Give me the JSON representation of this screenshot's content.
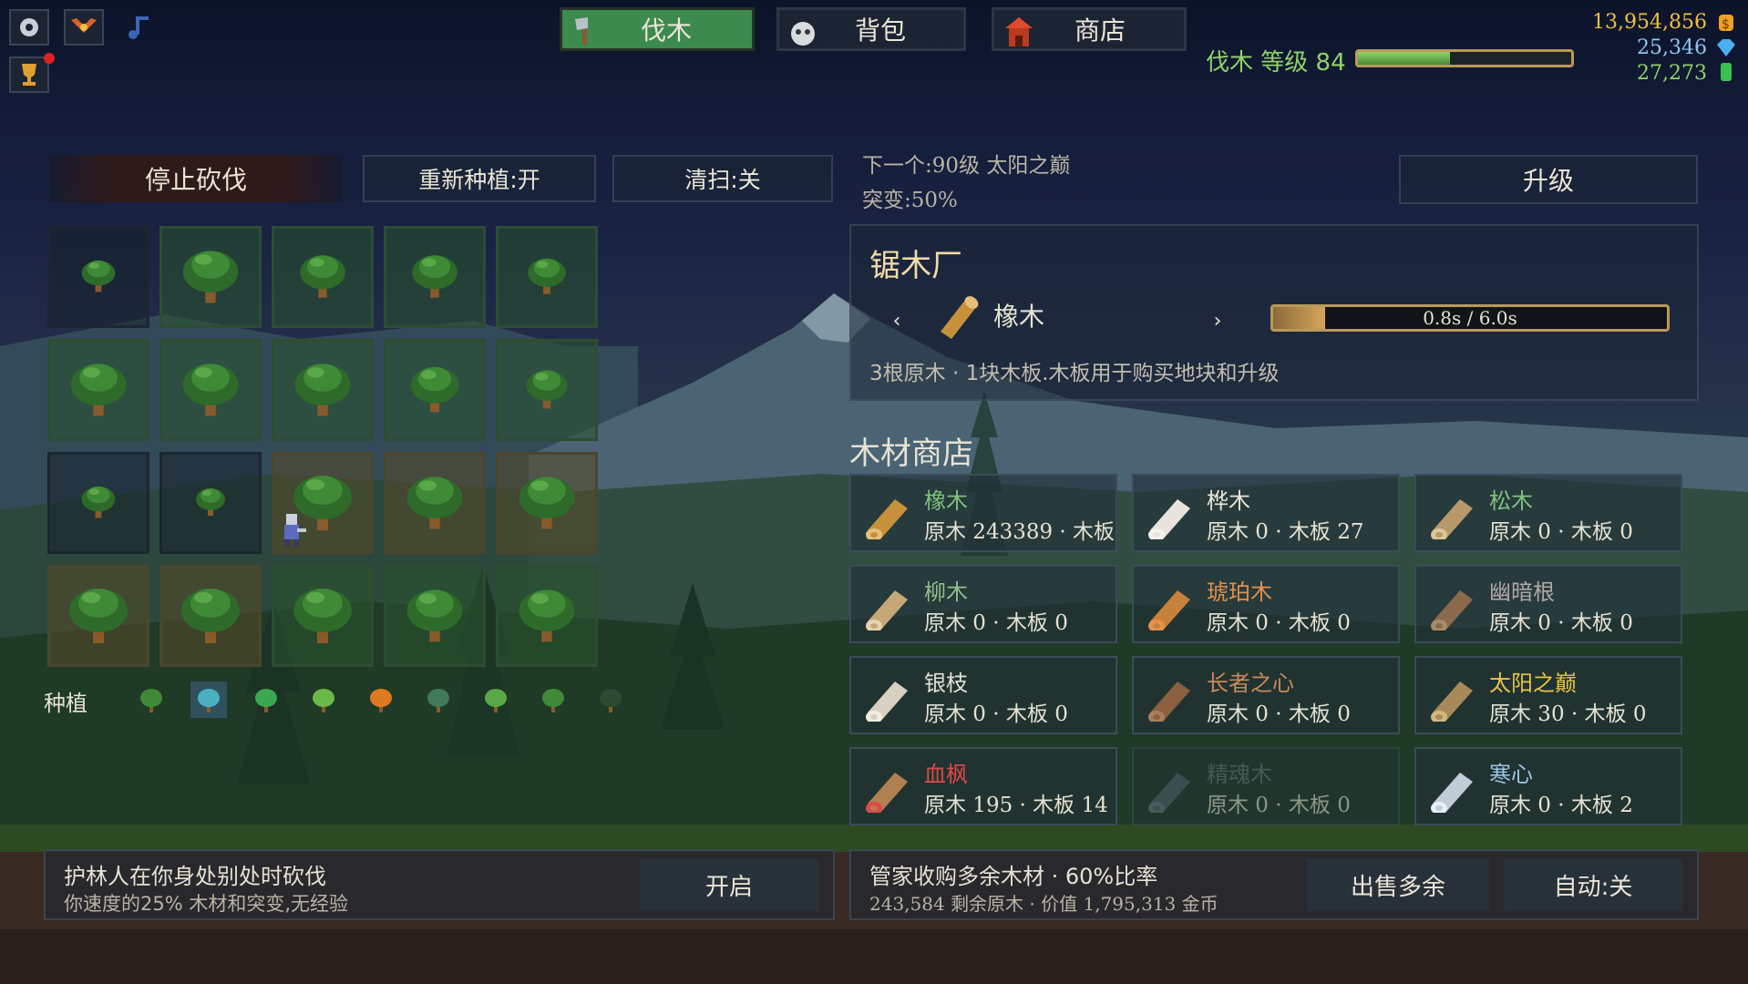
{
  "nav": {
    "tabs": [
      {
        "label": "伐木",
        "active": true
      },
      {
        "label": "背包",
        "active": false
      },
      {
        "label": "商店",
        "active": false
      }
    ]
  },
  "level": {
    "label": "伐木 等级 84",
    "progress": 0.43
  },
  "currency": {
    "gold": "13,954,856",
    "gems": "25,346",
    "emerald": "27,273"
  },
  "controls": {
    "stop": "停止砍伐",
    "replant": "重新种植:开",
    "sweep": "清扫:关",
    "upgrade": "升级"
  },
  "next": {
    "line1": "下一个:90级 太阳之巅",
    "line2": "突变:50%"
  },
  "sawmill": {
    "title": "锯木厂",
    "wood": "橡木",
    "progress_text": "0.8s / 6.0s",
    "progress": 0.133,
    "desc": "3根原木 · 1块木板.木板用于购买地块和升级"
  },
  "shop": {
    "title": "木材商店",
    "items": [
      {
        "name": "橡木",
        "count": "原木 243389 · 木板",
        "color": "#7ec27e"
      },
      {
        "name": "桦木",
        "count": "原木 0 · 木板 27",
        "color": "#ece7d6"
      },
      {
        "name": "松木",
        "count": "原木 0 · 木板 0",
        "color": "#7ec27e"
      },
      {
        "name": "柳木",
        "count": "原木 0 · 木板 0",
        "color": "#8fbf8a"
      },
      {
        "name": "琥珀木",
        "count": "原木 0 · 木板 0",
        "color": "#e0914a"
      },
      {
        "name": "幽暗根",
        "count": "原木 0 · 木板 0",
        "color": "#b3a8a8"
      },
      {
        "name": "银枝",
        "count": "原木 0 · 木板 0",
        "color": "#e6e2d2"
      },
      {
        "name": "长者之心",
        "count": "原木 0 · 木板 0",
        "color": "#c98a5a"
      },
      {
        "name": "太阳之巅",
        "count": "原木 30 · 木板 0",
        "color": "#e8c445"
      },
      {
        "name": "血枫",
        "count": "原木 195 · 木板 14",
        "color": "#e04848"
      },
      {
        "name": "精魂木",
        "count": "原木 0 · 木板 0",
        "color": "#6b7282"
      },
      {
        "name": "寒心",
        "count": "原木 0 · 木板 2",
        "color": "#9cc4e8"
      }
    ]
  },
  "plant": {
    "label": "种植"
  },
  "forester": {
    "title": "护林人在你身处别处时砍伐",
    "desc": "你速度的25% 木材和突变,无经验",
    "button": "开启"
  },
  "steward": {
    "title": "管家收购多余木材 · 60%比率",
    "desc": "243,584 剩余原木 · 价值 1,795,313 金币",
    "sell": "出售多余",
    "auto": "自动:关"
  }
}
